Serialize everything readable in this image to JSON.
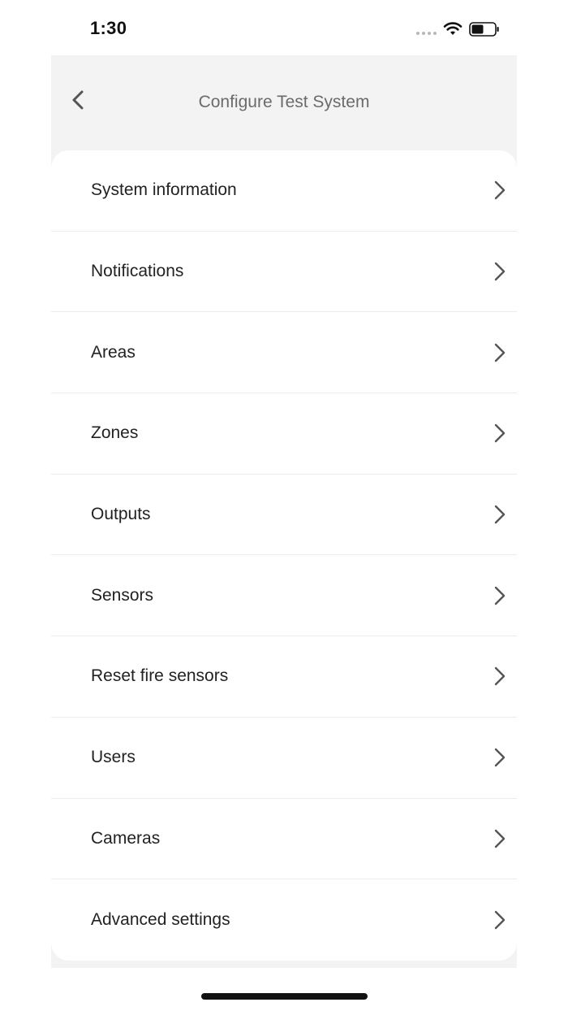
{
  "status_bar": {
    "time": "1:30",
    "icons": [
      "cellular-signal-icon",
      "wifi-icon",
      "battery-icon"
    ]
  },
  "nav": {
    "back_icon": "chevron-left-icon",
    "title": "Configure Test System"
  },
  "menu": {
    "chevron_icon": "chevron-right-icon",
    "items": [
      {
        "label": "System information"
      },
      {
        "label": "Notifications"
      },
      {
        "label": "Areas"
      },
      {
        "label": "Zones"
      },
      {
        "label": "Outputs"
      },
      {
        "label": "Sensors"
      },
      {
        "label": "Reset fire sensors"
      },
      {
        "label": "Users"
      },
      {
        "label": "Cameras"
      },
      {
        "label": "Advanced settings"
      }
    ]
  },
  "colors": {
    "header_background": "#f3f3f3",
    "card_background": "#ffffff",
    "title_text": "#6b6b6b",
    "item_text": "#222222",
    "divider": "#ececec"
  }
}
